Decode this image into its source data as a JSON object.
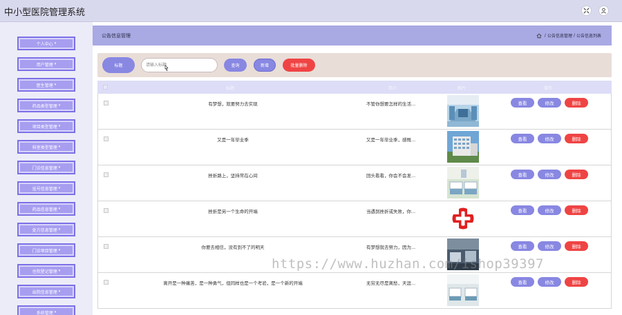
{
  "app": {
    "title": "中小型医院管理系统"
  },
  "colors": {
    "accent": "#8887e2",
    "danger": "#ef4444",
    "header_bg": "#a9a9e4",
    "topbar_bg": "#d9d9ee"
  },
  "topbar": {
    "icons": [
      "fullscreen-icon",
      "user-icon"
    ]
  },
  "sidebar": {
    "caret": "▾",
    "items": [
      {
        "label": "个人中心"
      },
      {
        "label": "用户管理"
      },
      {
        "label": "医生管理"
      },
      {
        "label": "药品类型管理"
      },
      {
        "label": "项目类型管理"
      },
      {
        "label": "科室类型管理"
      },
      {
        "label": "门诊信息管理"
      },
      {
        "label": "挂号信息管理"
      },
      {
        "label": "药品信息管理"
      },
      {
        "label": "处方信息管理"
      },
      {
        "label": "门诊项目管理"
      },
      {
        "label": "住院登记管理"
      },
      {
        "label": "出院信息管理"
      },
      {
        "label": "系统管理"
      }
    ]
  },
  "header": {
    "title": "公告信息管理",
    "breadcrumb": {
      "sep": "/",
      "items": [
        "公告信息管理",
        "公告信息列表"
      ]
    }
  },
  "search": {
    "label": "标题",
    "placeholder": "请输入标题",
    "query_button": "查询",
    "add_button": "新增",
    "batch_delete_button": "批量删除"
  },
  "table": {
    "columns": [
      "标题",
      "简介",
      "图片",
      "操作"
    ],
    "actions": {
      "view": "查看",
      "edit": "修改",
      "delete": "删除"
    },
    "rows": [
      {
        "title": "有梦想，就要努力去实现",
        "intro": "不管你想要怎样的生活...",
        "image": "hospital-corridor"
      },
      {
        "title": "又是一年毕业季",
        "intro": "又是一年毕业季，感慨...",
        "image": "hospital-building"
      },
      {
        "title": "挫折路上，坚持常在心间",
        "intro": "回头看看，你会不会发...",
        "image": "hospital-ward"
      },
      {
        "title": "挫折是另一个生命的开端",
        "intro": "当遇到挫折或失败，你...",
        "image": "red-cross"
      },
      {
        "title": "你要去相信，没有到不了的明天",
        "intro": "有梦想就去努力，因为...",
        "image": "hospital-room"
      },
      {
        "title": "离开是一种痛苦，是一种勇气，但同样也是一个考验，是一个新的开端",
        "intro": "无穷无尽是离愁，天涯...",
        "image": "hospital-beds"
      }
    ]
  },
  "watermark": "https://www.huzhan.com/ishop39397"
}
